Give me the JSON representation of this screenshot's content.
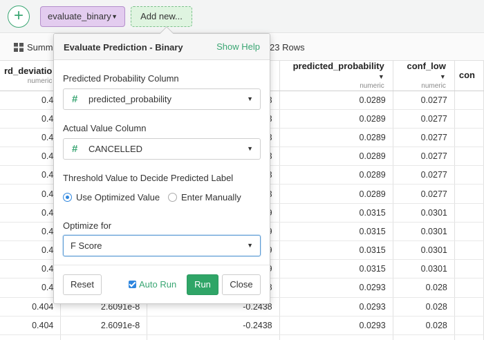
{
  "toolbar": {
    "add_icon": "+",
    "step_label": "evaluate_binary",
    "add_new_label": "Add new..."
  },
  "subbar": {
    "summary_label": "Summ",
    "rows_label": "23 Rows"
  },
  "table": {
    "columns": [
      {
        "name": "rd_deviatio",
        "type": "numeric"
      },
      {
        "name": "",
        "type": ""
      },
      {
        "name": "",
        "type": ""
      },
      {
        "name": "predicted_probability",
        "type": "numeric"
      },
      {
        "name": "conf_low",
        "type": "numeric"
      },
      {
        "name": "con",
        "type": ""
      }
    ],
    "rows": [
      [
        "0.4",
        "",
        "423",
        "0.0289",
        "0.0277",
        ""
      ],
      [
        "0.4",
        "",
        "423",
        "0.0289",
        "0.0277",
        ""
      ],
      [
        "0.4",
        "",
        "423",
        "0.0289",
        "0.0277",
        ""
      ],
      [
        "0.4",
        "",
        "423",
        "0.0289",
        "0.0277",
        ""
      ],
      [
        "0.4",
        "",
        "423",
        "0.0289",
        "0.0277",
        ""
      ],
      [
        "0.4",
        "",
        "423",
        "0.0289",
        "0.0277",
        ""
      ],
      [
        "0.4",
        "",
        "529",
        "0.0315",
        "0.0301",
        ""
      ],
      [
        "0.4",
        "",
        "529",
        "0.0315",
        "0.0301",
        ""
      ],
      [
        "0.4",
        "",
        "529",
        "0.0315",
        "0.0301",
        ""
      ],
      [
        "0.4",
        "",
        "529",
        "0.0315",
        "0.0301",
        ""
      ],
      [
        "0.4",
        "",
        "438",
        "0.0293",
        "0.028",
        ""
      ],
      [
        "0.404",
        "2.6091e-8",
        "-0.2438",
        "0.0293",
        "0.028",
        ""
      ],
      [
        "0.404",
        "2.6091e-8",
        "-0.2438",
        "0.0293",
        "0.028",
        ""
      ],
      [
        "",
        "",
        "",
        "",
        "",
        ""
      ]
    ]
  },
  "dialog": {
    "title": "Evaluate Prediction - Binary",
    "show_help": "Show Help",
    "predicted_label": "Predicted Probability Column",
    "predicted_value": "predicted_probability",
    "actual_label": "Actual Value Column",
    "actual_value": "CANCELLED",
    "threshold_label": "Threshold Value to Decide Predicted Label",
    "radio_optimized": "Use Optimized Value",
    "radio_manual": "Enter Manually",
    "optimize_label": "Optimize for",
    "optimize_value": "F Score",
    "hash_symbol": "#",
    "reset": "Reset",
    "auto_run": "Auto Run",
    "run": "Run",
    "close": "Close"
  },
  "colors": {
    "accent_green": "#3aa673",
    "step_purple": "#e3ccef",
    "checkbox_blue": "#2e86de"
  }
}
